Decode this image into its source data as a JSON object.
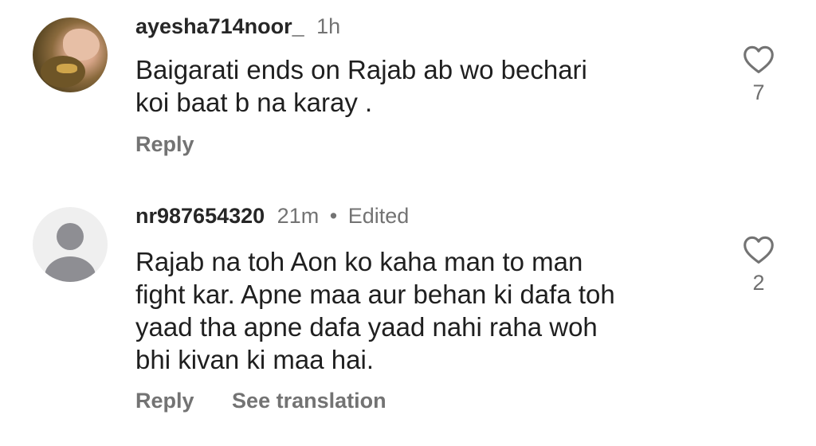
{
  "comments": [
    {
      "username": "ayesha714noor_",
      "time": "1h",
      "edited": "",
      "lines": [
        "Baigarati ends on Rajab ab wo bechari",
        "koi baat b na karay ."
      ],
      "like_count": "7",
      "reply_label": "Reply",
      "translate_label": ""
    },
    {
      "username": "nr987654320",
      "time": "21m",
      "edited": "Edited",
      "separator": "•",
      "lines": [
        "Rajab na toh Aon ko kaha man to man",
        "fight kar. Apne maa aur behan ki dafa toh",
        "yaad tha apne dafa yaad nahi raha woh",
        "bhi kivan ki maa hai."
      ],
      "like_count": "2",
      "reply_label": "Reply",
      "translate_label": "See translation"
    }
  ],
  "icons": {
    "like": "heart-outline-icon",
    "default_avatar": "person-silhouette-icon"
  },
  "colors": {
    "text": "#1f1f1f",
    "secondary": "#737373",
    "avatar_placeholder_bg": "#efefef",
    "avatar_placeholder_fg": "#8e8e93"
  }
}
